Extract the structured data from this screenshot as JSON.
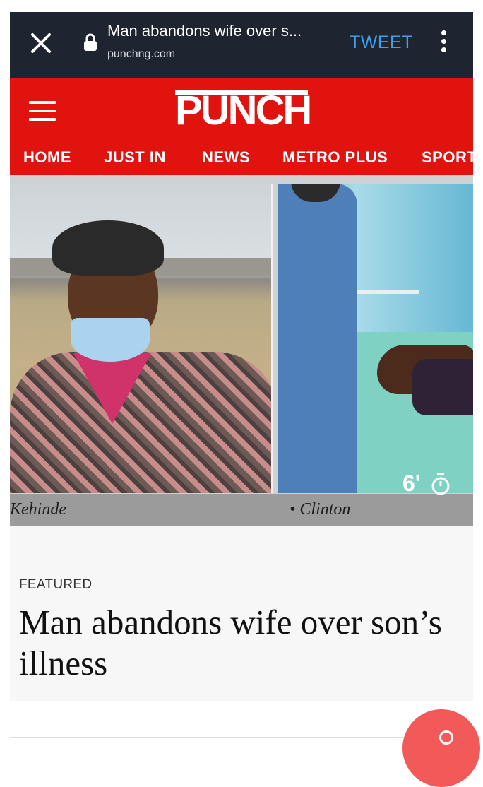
{
  "browser": {
    "title": "Man abandons wife over s...",
    "domain": "punchng.com",
    "tweet_label": "TWEET"
  },
  "site": {
    "logo": "PUNCH",
    "nav": [
      "HOME",
      "JUST IN",
      "NEWS",
      "METRO PLUS",
      "SPORT"
    ]
  },
  "image": {
    "caption_left": "Kehinde",
    "caption_right": "• Clinton",
    "read_time": "6'"
  },
  "article": {
    "category": "FEATURED",
    "headline": "Man abandons wife over son’s illness"
  },
  "colors": {
    "brand_red": "#e1130f",
    "topbar": "#1e2530",
    "tweet_blue": "#3aa0f3",
    "fab": "#f25a5a"
  },
  "icons": [
    "close-icon",
    "lock-icon",
    "more-vertical-icon",
    "hamburger-menu-icon",
    "timer-icon",
    "comment-icon"
  ]
}
